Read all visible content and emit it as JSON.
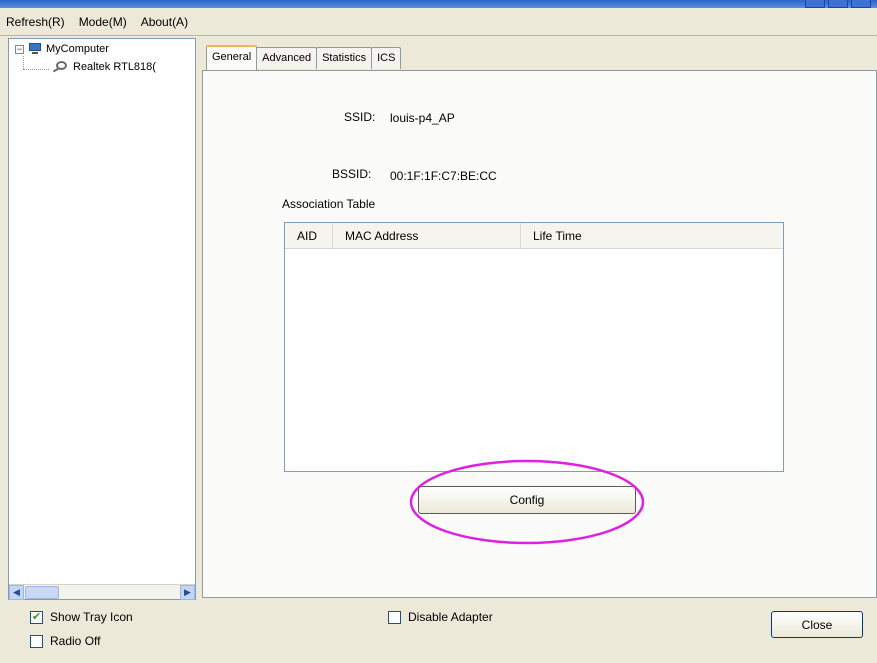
{
  "menu": {
    "refresh": "Refresh(R)",
    "mode": "Mode(M)",
    "about": "About(A)"
  },
  "tree": {
    "root_label": "MyComputer",
    "child_label": "Realtek RTL818("
  },
  "tabs": [
    {
      "label": "General",
      "active": true
    },
    {
      "label": "Advanced",
      "active": false
    },
    {
      "label": "Statistics",
      "active": false
    },
    {
      "label": "ICS",
      "active": false
    }
  ],
  "general": {
    "ssid_label": "SSID:",
    "ssid_value": "louis-p4_AP",
    "bssid_label": "BSSID:",
    "bssid_value": "00:1F:1F:C7:BE:CC",
    "association_table_label": "Association Table",
    "table_columns": [
      "AID",
      "MAC Address",
      "Life Time"
    ],
    "table_rows": [],
    "config_button": "Config"
  },
  "bottom": {
    "show_tray_icon": {
      "label": "Show Tray Icon",
      "checked": true
    },
    "radio_off": {
      "label": "Radio Off",
      "checked": false
    },
    "disable_adapter": {
      "label": "Disable Adapter",
      "checked": false
    },
    "close_button": "Close"
  },
  "colors": {
    "window_bg": "#ece9d8",
    "highlight_oval": "#e020e0",
    "check_mark": "#21a121"
  }
}
